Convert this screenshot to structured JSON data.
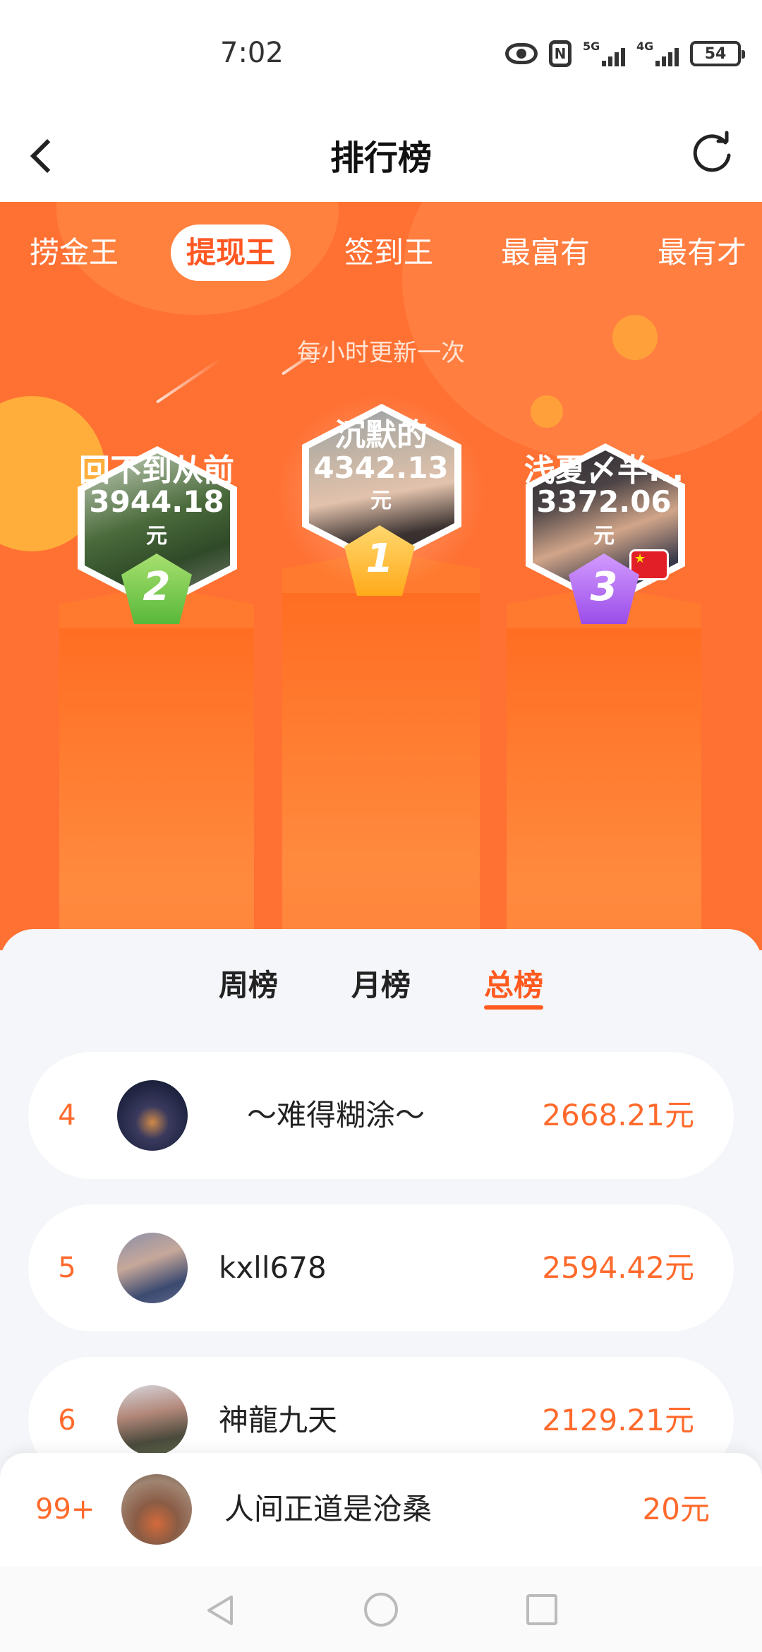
{
  "status_bar": {
    "time": "7:02",
    "net1": "5G",
    "net2": "4G",
    "battery": "54"
  },
  "header": {
    "title": "排行榜"
  },
  "category_tabs": [
    "捞金王",
    "提现王",
    "签到王",
    "最富有",
    "最有才"
  ],
  "active_category": "提现王",
  "update_note": "每小时更新一次",
  "podium": {
    "first": {
      "rank": "1",
      "name": "沉默的",
      "amount": "4342.13",
      "unit": "元"
    },
    "second": {
      "rank": "2",
      "name": "回不到从前",
      "amount": "3944.18",
      "unit": "元"
    },
    "third": {
      "rank": "3",
      "name": "浅夏〆半...",
      "amount": "3372.06",
      "unit": "元"
    }
  },
  "period_tabs": {
    "week": "周榜",
    "month": "月榜",
    "total": "总榜"
  },
  "active_period": "总榜",
  "rows": [
    {
      "rank": "4",
      "name": "～难得糊涂～",
      "amount": "2668.21元"
    },
    {
      "rank": "5",
      "name": "kxll678",
      "amount": "2594.42元"
    },
    {
      "rank": "6",
      "name": "神龍九天",
      "amount": "2129.21元"
    }
  ],
  "my_rank": {
    "rank": "99+",
    "name": "人间正道是沧桑",
    "amount": "20元"
  },
  "colors": {
    "accent": "#ff5a1f",
    "hero": "#ff7133",
    "amount": "#ff6a2c"
  }
}
